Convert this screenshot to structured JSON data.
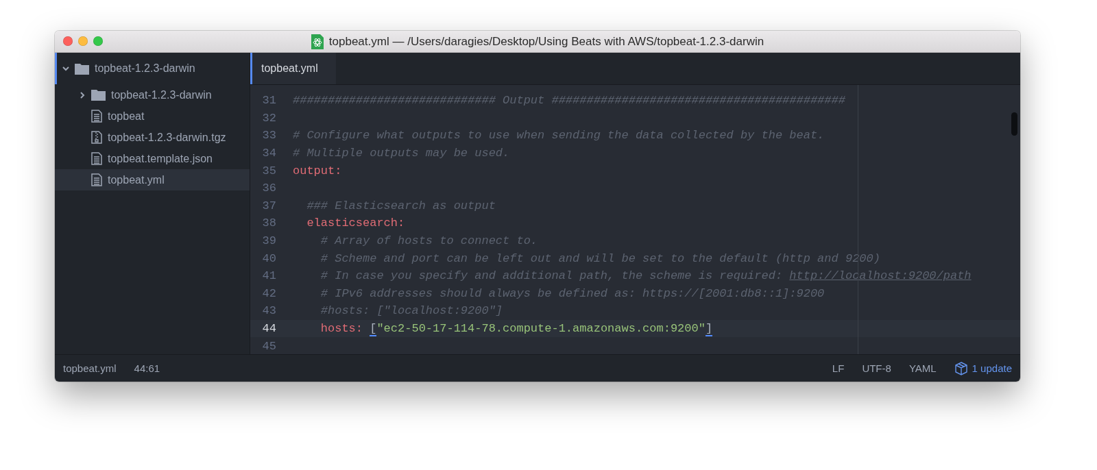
{
  "window": {
    "title": "topbeat.yml — /Users/daragies/Desktop/Using Beats with AWS/topbeat-1.2.3-darwin"
  },
  "sidebar": {
    "tree": [
      {
        "label": "topbeat-1.2.3-darwin",
        "kind": "folder",
        "expanded": true,
        "selected": false,
        "focused": true,
        "children": [
          {
            "label": "topbeat-1.2.3-darwin",
            "kind": "folder",
            "expanded": false,
            "selected": false
          },
          {
            "label": "topbeat",
            "kind": "text",
            "selected": false
          },
          {
            "label": "topbeat-1.2.3-darwin.tgz",
            "kind": "archive",
            "selected": false
          },
          {
            "label": "topbeat.template.json",
            "kind": "text",
            "selected": false
          },
          {
            "label": "topbeat.yml",
            "kind": "text",
            "selected": true
          }
        ]
      }
    ]
  },
  "tabs": [
    {
      "label": "topbeat.yml",
      "selected": true
    }
  ],
  "editor": {
    "lines": [
      {
        "number": "31",
        "cursor": false,
        "tokens": [
          {
            "kind": "comment",
            "text": "############################# Output ##########################################"
          }
        ]
      },
      {
        "number": "32",
        "cursor": false
      },
      {
        "number": "33",
        "cursor": false,
        "tokens": [
          {
            "kind": "comment",
            "text": "# Configure what outputs to use when sending the data collected by the beat."
          }
        ]
      },
      {
        "number": "34",
        "cursor": false,
        "tokens": [
          {
            "kind": "comment",
            "text": "# Multiple outputs may be used."
          }
        ]
      },
      {
        "number": "35",
        "cursor": false,
        "tokens": [
          {
            "kind": "key",
            "text": "output:"
          }
        ]
      },
      {
        "number": "36",
        "cursor": false
      },
      {
        "number": "37",
        "cursor": false,
        "tokens": [
          {
            "kind": "comment",
            "text": "  ### Elasticsearch as output"
          }
        ]
      },
      {
        "number": "38",
        "cursor": false,
        "tokens": [
          {
            "kind": "key",
            "text": "  elasticsearch:"
          }
        ]
      },
      {
        "number": "39",
        "cursor": false,
        "tokens": [
          {
            "kind": "comment",
            "text": "    # Array of hosts to connect to."
          }
        ]
      },
      {
        "number": "40",
        "cursor": false,
        "tokens": [
          {
            "kind": "comment",
            "text": "    # Scheme and port can be left out and will be set to the default (http and 9200)"
          }
        ]
      },
      {
        "number": "41",
        "cursor": false,
        "tokens": [
          {
            "kind": "comment",
            "text": "    # In case you specify and additional path, the scheme is required: "
          },
          {
            "kind": "link",
            "text": "http://localhost:9200/path"
          }
        ]
      },
      {
        "number": "42",
        "cursor": false,
        "tokens": [
          {
            "kind": "comment",
            "text": "    # IPv6 addresses should always be defined as: https://[2001:db8::1]:9200"
          }
        ]
      },
      {
        "number": "43",
        "cursor": false,
        "tokens": [
          {
            "kind": "comment",
            "text": "    #hosts: [\"localhost:9200\"]"
          }
        ]
      },
      {
        "number": "44",
        "cursor": true,
        "tokens": [
          {
            "kind": "key",
            "text": "    hosts: "
          },
          {
            "kind": "bracket",
            "text": "["
          },
          {
            "kind": "string",
            "text": "\"ec2-50-17-114-78.compute-1.amazonaws.com:9200\""
          },
          {
            "kind": "bracket",
            "text": "]"
          }
        ]
      },
      {
        "number": "45",
        "cursor": false
      }
    ]
  },
  "status_bar": {
    "file": "topbeat.yml",
    "position": "44:61",
    "items": [
      "LF",
      "UTF-8",
      "YAML"
    ],
    "update": "1 update"
  }
}
